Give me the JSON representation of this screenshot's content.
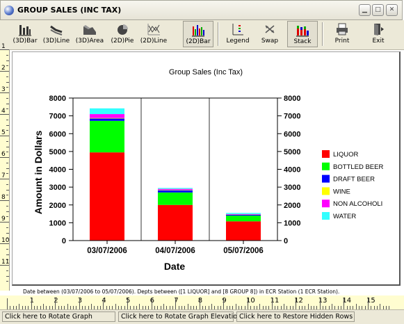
{
  "window": {
    "title": "GROUP SALES (INC TAX)"
  },
  "toolbar": {
    "buttons": [
      {
        "label": "(3D)Bar"
      },
      {
        "label": "(3D)Line"
      },
      {
        "label": "(3D)Area"
      },
      {
        "label": "(2D)Pie"
      },
      {
        "label": "(2D)Line"
      },
      {
        "label": "(2D)Bar",
        "pressed": true
      },
      {
        "label": "Legend"
      },
      {
        "label": "Swap"
      },
      {
        "label": "Stack",
        "pressed": true
      },
      {
        "label": "Print"
      },
      {
        "label": "Exit"
      }
    ]
  },
  "ruler": {
    "vertical": [
      "1",
      "2",
      "3",
      "4",
      "5",
      "6",
      "7",
      "8",
      "9",
      "10",
      "11"
    ],
    "horizontal": [
      "1",
      "2",
      "3",
      "4",
      "5",
      "6",
      "7",
      "8",
      "9",
      "10",
      "11",
      "12",
      "13",
      "14",
      "15"
    ]
  },
  "caption": "Date between   (03/07/2006 to 05/07/2006). Depts between ([1   LIQUOR] and [8   GROUP 8]) in ECR Station (1   ECR Station).",
  "status": {
    "rotate": "Click here to Rotate Graph",
    "elevation": "Click here to Rotate Graph Elevation",
    "restore": "Click here to Restore Hidden Rows"
  },
  "chart_data": {
    "type": "bar",
    "stacked": true,
    "title": "Group Sales (Inc Tax)",
    "xlabel": "Date",
    "ylabel": "Amount in Dollars",
    "ylim": [
      0,
      8000
    ],
    "yticks": [
      0,
      1000,
      2000,
      3000,
      4000,
      5000,
      6000,
      7000,
      8000
    ],
    "categories": [
      "03/07/2006",
      "04/07/2006",
      "05/07/2006"
    ],
    "legend_position": "right",
    "grid": true,
    "series": [
      {
        "name": "LIQUOR",
        "color": "#ff0000",
        "values": [
          4950,
          2000,
          1080
        ]
      },
      {
        "name": "BOTTLED BEER",
        "color": "#00ff00",
        "values": [
          1770,
          700,
          320
        ]
      },
      {
        "name": "DRAFT BEER",
        "color": "#0000ff",
        "values": [
          130,
          120,
          50
        ]
      },
      {
        "name": "WINE",
        "color": "#ffff00",
        "values": [
          30,
          20,
          10
        ]
      },
      {
        "name": "NON ALCOHOLI",
        "color": "#ff00ff",
        "values": [
          220,
          60,
          30
        ]
      },
      {
        "name": "WATER",
        "color": "#33ffff",
        "values": [
          320,
          50,
          60
        ]
      }
    ]
  }
}
